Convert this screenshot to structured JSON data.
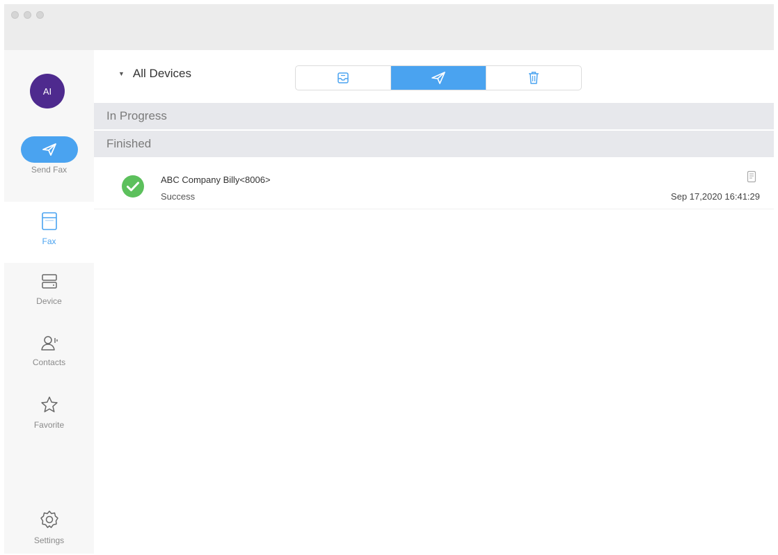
{
  "window": {
    "traffic_lights": [
      "close",
      "minimize",
      "zoom"
    ]
  },
  "user": {
    "initials": "AI",
    "avatar_color": "#4e2a8e"
  },
  "sidebar": {
    "items": [
      {
        "id": "send-fax",
        "label": "Send Fax",
        "icon": "paper-plane-icon"
      },
      {
        "id": "fax",
        "label": "Fax",
        "icon": "fax-tray-icon",
        "selected": true
      },
      {
        "id": "device",
        "label": "Device",
        "icon": "server-icon"
      },
      {
        "id": "contacts",
        "label": "Contacts",
        "icon": "contacts-icon"
      },
      {
        "id": "favorite",
        "label": "Favorite",
        "icon": "star-icon"
      },
      {
        "id": "settings",
        "label": "Settings",
        "icon": "gear-icon"
      }
    ]
  },
  "toolbar": {
    "device_filter": "All Devices",
    "tabs": [
      {
        "id": "inbox",
        "icon": "inbox-icon"
      },
      {
        "id": "sent",
        "icon": "paper-plane-icon",
        "active": true
      },
      {
        "id": "trash",
        "icon": "trash-icon"
      }
    ]
  },
  "sections": {
    "in_progress": "In Progress",
    "finished": "Finished"
  },
  "fax_list": [
    {
      "title": "ABC Company Billy<8006>",
      "status": "Success",
      "timestamp": "Sep 17,2020 16:41:29",
      "status_icon": "check-circle-icon"
    }
  ],
  "colors": {
    "accent": "#4aa3f0",
    "success": "#5cc05c",
    "section_bg": "#e7e8ec"
  }
}
